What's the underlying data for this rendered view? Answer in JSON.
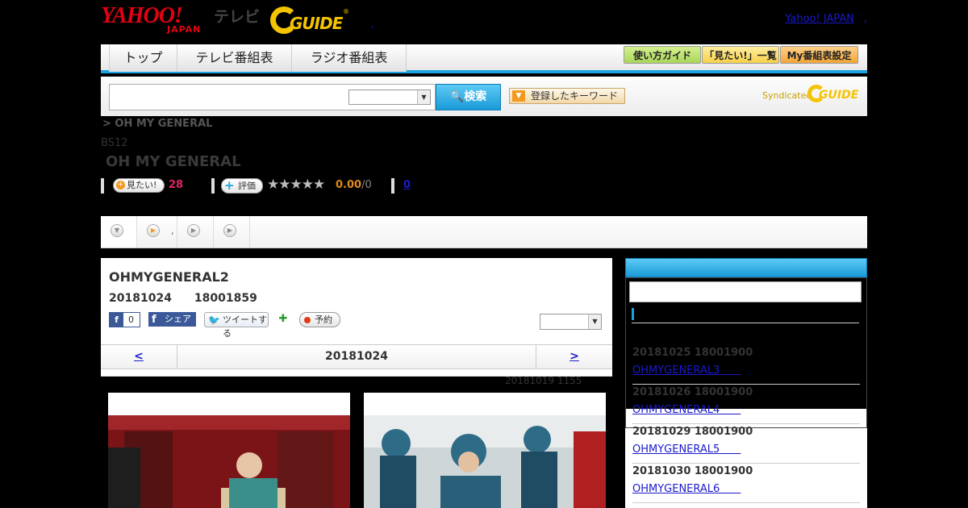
{
  "header": {
    "logo_text": "YAHOO!",
    "logo_sub": "JAPAN",
    "tv_label": "テレビ",
    "guide_text": "GUIDE",
    "guide_mark": "®",
    "sep": ",",
    "yahoo_japan_link": "Yahoo! JAPAN",
    "yj_dot": ","
  },
  "nav": {
    "tabs": [
      {
        "label": "トップ"
      },
      {
        "label": "テレビ番組表"
      },
      {
        "label": "ラジオ番組表"
      }
    ],
    "buttons": [
      {
        "label": "使い方ガイド",
        "color": "#a9d65a"
      },
      {
        "label": "「見たい!」一覧",
        "color": "#f7d04a"
      },
      {
        "label": "My番組表設定",
        "color": "#f2a636"
      }
    ]
  },
  "search": {
    "placeholder": "",
    "select_value": "",
    "button_label": "検索",
    "keyword_label": "登録したキーワード",
    "syndicated_label": "Syndicated",
    "syndicated_guide": "GUIDE"
  },
  "breadcrumb": ">  OH MY GENERAL",
  "program": {
    "channel": "BS12",
    "title": "OH MY GENERAL",
    "mitai_label": "見たい!",
    "mitai_count": "28",
    "hyoka_label": "評価",
    "stars": "★★★★★",
    "score": "0.00",
    "score_max": "/0",
    "review_count": "0"
  },
  "tabs": [
    {
      "label": ""
    },
    {
      "label": ","
    },
    {
      "label": ""
    },
    {
      "label": ""
    }
  ],
  "episode": {
    "title": "OHMYGENERAL2",
    "datetime": "20181024　　18001859",
    "fb_count": "0",
    "share_label": "シェア",
    "tweet_label": "ツイートする",
    "yoyaku_label": "予約",
    "select_value": "",
    "prev": "<",
    "current_date": "20181024",
    "next": ">",
    "updated": "20181019  1155"
  },
  "sidebar": {
    "items": [
      {
        "datetime": "20181025  18001900",
        "title": "OHMYGENERAL3　　"
      },
      {
        "datetime": "20181026  18001900",
        "title": "OHMYGENERAL4　　"
      },
      {
        "datetime": "20181029  18001900",
        "title": "OHMYGENERAL5　　"
      },
      {
        "datetime": "20181030  18001900",
        "title": "OHMYGENERAL6　　"
      }
    ]
  }
}
